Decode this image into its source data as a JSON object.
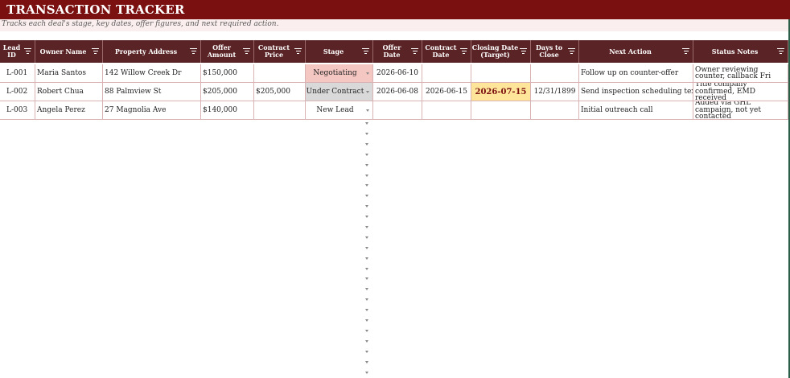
{
  "title": "TRANSACTION TRACKER",
  "subtitle": "Tracks each deal's stage, key dates, offer figures, and next required action.",
  "columns": [
    {
      "key": "lead_id",
      "label": "Lead ID"
    },
    {
      "key": "owner_name",
      "label": "Owner Name"
    },
    {
      "key": "property_address",
      "label": "Property Address"
    },
    {
      "key": "offer_amount",
      "label": "Offer Amount"
    },
    {
      "key": "contract_price",
      "label": "Contract Price"
    },
    {
      "key": "stage",
      "label": "Stage"
    },
    {
      "key": "offer_date",
      "label": "Offer Date"
    },
    {
      "key": "contract_date",
      "label": "Contract Date"
    },
    {
      "key": "closing_date",
      "label": "Closing Date (Target)"
    },
    {
      "key": "days_to_close",
      "label": "Days to Close"
    },
    {
      "key": "next_action",
      "label": "Next Action"
    },
    {
      "key": "status_notes",
      "label": "Status Notes"
    }
  ],
  "rows": [
    {
      "lead_id": "L-001",
      "owner_name": "Maria Santos",
      "property_address": "142 Willow Creek Dr",
      "offer_amount": "$150,000",
      "contract_price": "",
      "stage": "Negotiating",
      "offer_date": "2026-06-10",
      "contract_date": "",
      "closing_date": "",
      "days_to_close": "",
      "next_action": "Follow up on counter-offer",
      "status_notes": "Owner reviewing counter, callback Fri"
    },
    {
      "lead_id": "L-002",
      "owner_name": "Robert Chua",
      "property_address": "88 Palmview St",
      "offer_amount": "$205,000",
      "contract_price": "$205,000",
      "stage": "Under Contract",
      "offer_date": "2026-06-08",
      "contract_date": "2026-06-15",
      "closing_date": "2026-07-15",
      "days_to_close": "12/31/1899",
      "next_action": "Send inspection scheduling text",
      "status_notes": "Title company confirmed, EMD received"
    },
    {
      "lead_id": "L-003",
      "owner_name": "Angela Perez",
      "property_address": "27 Magnolia Ave",
      "offer_amount": "$140,000",
      "contract_price": "",
      "stage": "New Lead",
      "offer_date": "",
      "contract_date": "",
      "closing_date": "",
      "days_to_close": "",
      "next_action": "Initial outreach call",
      "status_notes": "Added via GHL campaign, not yet contacted"
    }
  ],
  "colors": {
    "title_bg": "#7a1010",
    "header_bg": "#5a2326",
    "subtitle_bg": "#fbeeee",
    "negotiating_bg": "#f4c7c3",
    "under_contract_bg": "#d9d9d9",
    "closing_highlight_bg": "#ffe599",
    "closing_highlight_text": "#7a1010"
  },
  "icons": {
    "filter": "filter-icon",
    "dropdown": "chevron-down-icon"
  }
}
